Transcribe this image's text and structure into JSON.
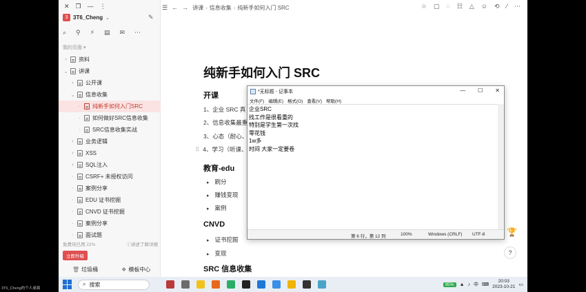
{
  "sidebar": {
    "window_controls": [
      "✕",
      "❐",
      "—",
      "⋮"
    ],
    "workspace_logo": "3",
    "workspace_name": "3T6_Cheng",
    "section_label": "我的页面 ▾",
    "tree": [
      {
        "label": "资料",
        "level": 0,
        "arrow": "›"
      },
      {
        "label": "讲课",
        "level": 0,
        "arrow": "⌄"
      },
      {
        "label": "公开课",
        "level": 1,
        "arrow": "›"
      },
      {
        "label": "信息收集",
        "level": 1,
        "arrow": "⌄"
      },
      {
        "label": "纯新手如何入门SRC",
        "level": 2,
        "arrow": "·",
        "active": true
      },
      {
        "label": "如何做好SRC信息收集",
        "level": 2,
        "arrow": "·"
      },
      {
        "label": "SRC信息收集实战",
        "level": 2,
        "arrow": "·"
      },
      {
        "label": "业务逻辑",
        "level": 1,
        "arrow": "›"
      },
      {
        "label": "XSS",
        "level": 1,
        "arrow": "›"
      },
      {
        "label": "SQL注入",
        "level": 1,
        "arrow": "›"
      },
      {
        "label": "CSRF+ 未授权访问",
        "level": 1,
        "arrow": "·"
      },
      {
        "label": "案例分享",
        "level": 1,
        "arrow": "·"
      },
      {
        "label": "EDU 证书挖掘",
        "level": 1,
        "arrow": "·"
      },
      {
        "label": "CNVD 证书挖掘",
        "level": 1,
        "arrow": "·"
      },
      {
        "label": "案例分享",
        "level": 1,
        "arrow": "·"
      },
      {
        "label": "面试题",
        "level": 1,
        "arrow": "·"
      }
    ],
    "quota_text": "免费块已用 22%",
    "quota_link": "ⓘ讲述了解详细",
    "upgrade_label": "立即升级",
    "trash_label": "垃圾桶",
    "template_label": "模板中心"
  },
  "topbar": {
    "breadcrumb": [
      "讲课",
      "信息收集",
      "纯新手如何入门 SRC"
    ]
  },
  "document": {
    "title": "纯新手如何入门 SRC",
    "sections": {
      "kaike": "开课",
      "edu": "教育-edu",
      "cnvd": "CNVD",
      "src": "SRC 信息收集"
    },
    "kaike_items": [
      "1、企业 SRC 真",
      "2、信息收集最重",
      "3、心态（耐心、",
      "4、学习（听课、"
    ],
    "edu_items": [
      "刷分",
      "赚钱变现",
      "案例"
    ],
    "cnvd_items": [
      "证书挖掘",
      "变现"
    ]
  },
  "notepad": {
    "title": "*无标题 - 记事本",
    "menu": [
      "文件(F)",
      "编辑(E)",
      "格式(O)",
      "查看(V)",
      "帮助(H)"
    ],
    "lines": [
      "企业SRC",
      "找工作是很看重的",
      "特别是学生第一次找",
      "零花钱",
      "1w多",
      "时间 大家一定要卷"
    ],
    "status": {
      "position": "第 6 行，第 12 列",
      "zoom": "100%",
      "line_ending": "Windows (CRLF)",
      "encoding": "UTF-8"
    }
  },
  "taskbar": {
    "search_label": "搜索",
    "battery": "95%",
    "ime": "中",
    "time": "20:03",
    "date": "2023-10-21",
    "user_tag": "3T6_Cheng的个人桌面"
  },
  "colors": {
    "accent": "#e05050",
    "active_bg": "#fbe3e3"
  }
}
